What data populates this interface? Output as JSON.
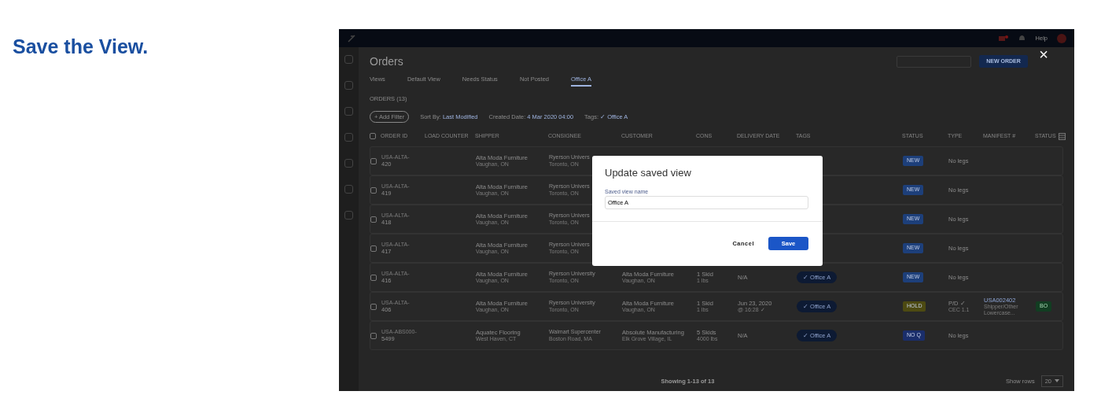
{
  "heading": "Save the View.",
  "app": {
    "help": "Help",
    "page_title": "Orders",
    "new_order": "NEW ORDER",
    "tabs": [
      {
        "label": "Views",
        "selected": false
      },
      {
        "label": "Default View",
        "selected": false
      },
      {
        "label": "Needs Status",
        "selected": false
      },
      {
        "label": "Not Posted",
        "selected": false
      },
      {
        "label": "Office A",
        "selected": true
      }
    ],
    "orders_count": "ORDERS (13)",
    "filters": [
      {
        "kind": "button",
        "label": "+ Add Filter"
      },
      {
        "kind": "dropdown",
        "label": "Sort By:",
        "value": "Last Modified"
      },
      {
        "kind": "dropdown",
        "label": "Created Date:",
        "value": "4 Mar 2020 04:00"
      },
      {
        "kind": "dropdown",
        "label": "Tags:",
        "value": "✓ Office A"
      }
    ],
    "select_all_checked": false,
    "columns": [
      "ORDER ID",
      "LOAD COUNTER",
      "SHIPPER",
      "CONSIGNEE",
      "CUSTOMER",
      "CONS",
      "DELIVERY DATE",
      "TAGS",
      "STATUS",
      "TYPE",
      "MANIFEST #",
      "STATUS"
    ],
    "rows": [
      {
        "checked": false,
        "prefix": "USA-ALTA-",
        "number": "420",
        "shipper": "Alta Moda Furniture",
        "shipper_city": "Vaughan, ON",
        "consignee": "Ryerson Univers",
        "consignee_city": "Toronto, ON",
        "status": "NEW",
        "color": "#1d3f7a",
        "type": "No legs"
      },
      {
        "checked": false,
        "prefix": "USA-ALTA-",
        "number": "419",
        "shipper": "Alta Moda Furniture",
        "shipper_city": "Vaughan, ON",
        "consignee": "Ryerson Univers",
        "consignee_city": "Toronto, ON",
        "status": "NEW",
        "color": "#1d3f7a",
        "type": "No legs"
      },
      {
        "checked": false,
        "prefix": "USA-ALTA-",
        "number": "418",
        "shipper": "Alta Moda Furniture",
        "shipper_city": "Vaughan, ON",
        "consignee": "Ryerson Univers",
        "consignee_city": "Toronto, ON",
        "status": "NEW",
        "color": "#1d3f7a",
        "type": "No legs"
      },
      {
        "checked": false,
        "prefix": "USA-ALTA-",
        "number": "417",
        "shipper": "Alta Moda Furniture",
        "shipper_city": "Vaughan, ON",
        "consignee": "Ryerson Univers",
        "consignee_city": "Toronto, ON",
        "status": "NEW",
        "color": "#1d3f7a",
        "type": "No legs"
      },
      {
        "checked": false,
        "prefix": "USA-ALTA-",
        "number": "416",
        "shipper": "Alta Moda Furniture",
        "shipper_city": "Vaughan, ON",
        "consignee": "Ryerson University",
        "consignee_city": "Toronto, ON",
        "customer": "Alta Moda Furniture",
        "customer_city": "Vaughan, ON",
        "cons": "1 Skid",
        "cons_weight": "1 lbs",
        "delivery": "N/A",
        "tag": "✓ Office A",
        "status": "NEW",
        "color": "#1d3f7a",
        "type": "No legs"
      },
      {
        "checked": false,
        "prefix": "USA-ALTA-",
        "number": "406",
        "shipper": "Alta Moda Furniture",
        "shipper_city": "Vaughan, ON",
        "consignee": "Ryerson University",
        "consignee_city": "Toronto, ON",
        "customer": "Alta Moda Furniture",
        "customer_city": "Vaughan, ON",
        "cons": "1 Skid",
        "cons_weight": "1 lbs",
        "delivery": "Jun 23, 2020",
        "delivery_time": "@ 16:28 ✓",
        "tag": "✓ Office A",
        "status": "HOLD",
        "color": "#4d4a12",
        "type": "P/D ✓",
        "type_sub": "CEC 1.1",
        "manifest": "USA002402",
        "manifest_sub": "Shipper/Other Lowercase...",
        "badge": "BO"
      },
      {
        "checked": false,
        "prefix": "USA-ABS000-",
        "number": "5499",
        "shipper": "Aquatec Flooring",
        "shipper_city": "West Haven, CT",
        "consignee": "Walmart Supercenter",
        "consignee_city": "Boston Road, MA",
        "customer": "Absolute Manufacturing",
        "customer_city": "Elk Grove Village, IL",
        "cons": "5 Skids",
        "cons_weight": "4000 lbs",
        "delivery": "N/A",
        "tag": "✓ Office A",
        "status": "NO Q",
        "color": "#1a2e6b",
        "type": "No legs"
      }
    ],
    "showing": "Showing 1-13 of 13",
    "show_rows_label": "Show rows",
    "show_rows_value": "20"
  },
  "modal": {
    "title": "Update saved view",
    "field_label": "Saved view name",
    "field_value": "Office A",
    "cancel": "Cancel",
    "save": "Save"
  },
  "close": "×"
}
